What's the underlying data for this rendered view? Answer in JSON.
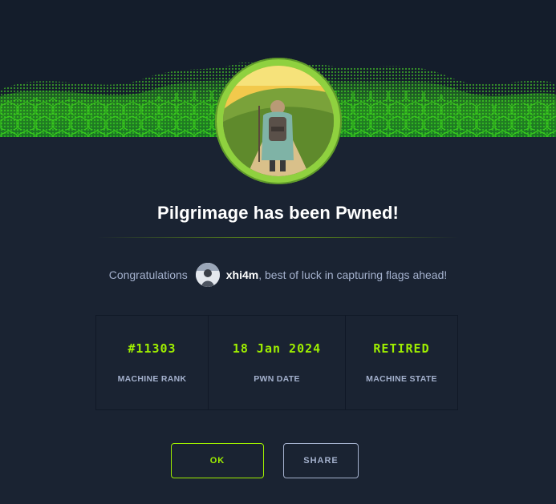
{
  "modal": {
    "title": "Pilgrimage has been Pwned!",
    "machine_name": "Pilgrimage"
  },
  "congrats": {
    "prefix": "Congratulations",
    "username": "xhi4m",
    "suffix": ", best of luck in capturing flags ahead!"
  },
  "stats": [
    {
      "value": "#11303",
      "label": "MACHINE RANK"
    },
    {
      "value": "18 Jan 2024",
      "label": "PWN DATE"
    },
    {
      "value": "RETIRED",
      "label": "MACHINE STATE"
    }
  ],
  "buttons": {
    "ok": "OK",
    "share": "SHARE"
  },
  "colors": {
    "background": "#1a2332",
    "accent": "#9fef00",
    "muted_text": "#a4b1cd",
    "avatar_ring": "#8fd13f"
  }
}
